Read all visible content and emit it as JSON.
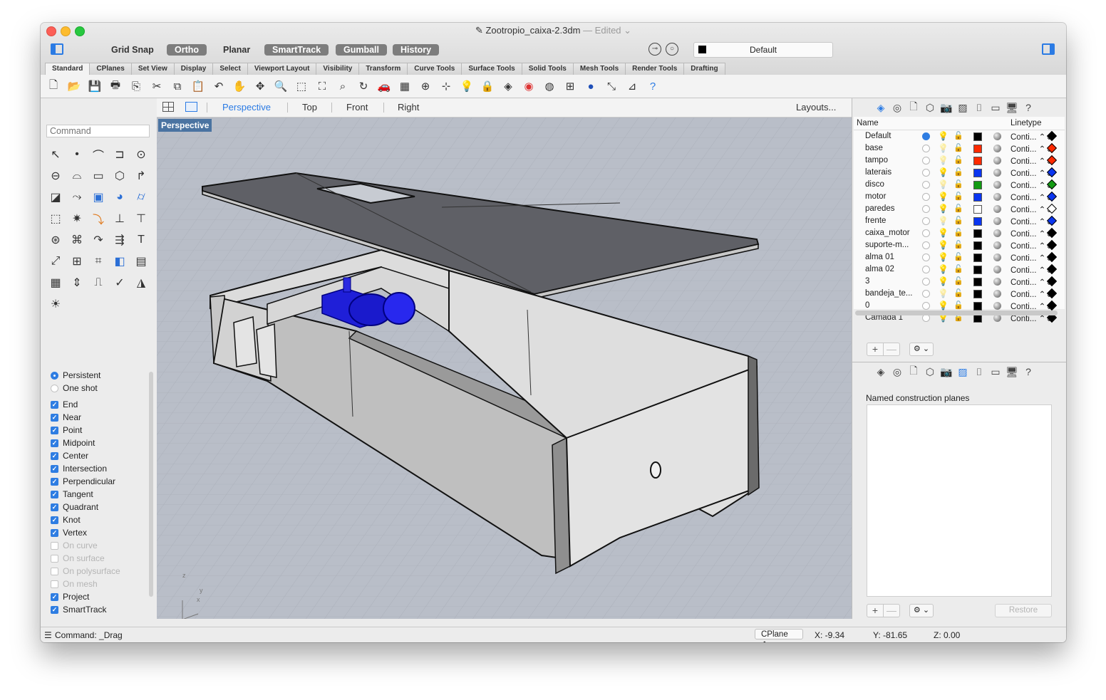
{
  "window": {
    "title": "Zootropio_caixa-2.3dm",
    "title_suffix": "— Edited ⌄"
  },
  "modes": [
    {
      "label": "Grid Snap",
      "active": false
    },
    {
      "label": "Ortho",
      "active": true
    },
    {
      "label": "Planar",
      "active": false
    },
    {
      "label": "SmartTrack",
      "active": true
    },
    {
      "label": "Gumball",
      "active": true
    },
    {
      "label": "History",
      "active": true
    }
  ],
  "layer_selector": {
    "current": "Default",
    "color": "#000000"
  },
  "tabs": [
    "Standard",
    "CPlanes",
    "Set View",
    "Display",
    "Select",
    "Viewport Layout",
    "Visibility",
    "Transform",
    "Curve Tools",
    "Surface Tools",
    "Solid Tools",
    "Mesh Tools",
    "Render Tools",
    "Drafting"
  ],
  "active_tab": "Standard",
  "toolbar_icons": [
    "new-file-icon",
    "open-folder-icon",
    "save-icon",
    "print-icon",
    "import-icon",
    "cut-icon",
    "copy-icon",
    "paste-icon",
    "undo-icon",
    "pan-hand-icon",
    "move-view-icon",
    "zoom-icon",
    "zoom-window-icon",
    "zoom-extents-icon",
    "zoom-selected-icon",
    "rotate-view-icon",
    "car-render-icon",
    "grid-icon",
    "cplane-icon",
    "snap-icon",
    "light-icon",
    "lock-icon",
    "layer-icon",
    "color-wheel-icon",
    "wireframe-sphere-icon",
    "mesh-sphere-icon",
    "render-sphere-icon",
    "dimension-icon",
    "measure-icon",
    "help-icon"
  ],
  "command": {
    "placeholder": "Command"
  },
  "palette_icons": [
    "select-arrow-icon",
    "point-icon",
    "polyline-icon",
    "curve-icon",
    "circle-icon",
    "ellipse-icon",
    "arc-icon",
    "rectangle-icon",
    "polygon-icon",
    "fillet-icon",
    "surface-icon",
    "sweep-icon",
    "box-icon",
    "sphere-icon",
    "cylinder-icon",
    "extrude-icon",
    "explode-icon",
    "trim-icon",
    "split-icon",
    "join-icon",
    "boolean-icon",
    "group-icon",
    "curve-from-object-icon",
    "offset-icon",
    "text-icon",
    "transform-icon",
    "array-icon",
    "properties-icon",
    "block-icon",
    "dimension-icon",
    "grid-array-icon",
    "align-icon",
    "analyze-icon",
    "check-icon",
    "display-mode-icon",
    "sun-icon"
  ],
  "osnap": {
    "radio": [
      {
        "label": "Persistent",
        "checked": true
      },
      {
        "label": "One shot",
        "checked": false
      }
    ],
    "items": [
      {
        "label": "End",
        "checked": true
      },
      {
        "label": "Near",
        "checked": true
      },
      {
        "label": "Point",
        "checked": true
      },
      {
        "label": "Midpoint",
        "checked": true
      },
      {
        "label": "Center",
        "checked": true
      },
      {
        "label": "Intersection",
        "checked": true
      },
      {
        "label": "Perpendicular",
        "checked": true
      },
      {
        "label": "Tangent",
        "checked": true
      },
      {
        "label": "Quadrant",
        "checked": true
      },
      {
        "label": "Knot",
        "checked": true
      },
      {
        "label": "Vertex",
        "checked": true
      },
      {
        "label": "On curve",
        "checked": false
      },
      {
        "label": "On surface",
        "checked": false
      },
      {
        "label": "On polysurface",
        "checked": false
      },
      {
        "label": "On mesh",
        "checked": false
      },
      {
        "label": "Project",
        "checked": true
      },
      {
        "label": "SmartTrack",
        "checked": true
      }
    ]
  },
  "viewport_tabs": [
    "Perspective",
    "Top",
    "Front",
    "Right"
  ],
  "active_viewport": "Perspective",
  "layouts_label": "Layouts...",
  "viewport_label": "Perspective",
  "axes": {
    "z": "z",
    "y": "y",
    "x": "x"
  },
  "layers": {
    "headers": {
      "name": "Name",
      "linetype": "Linetype"
    },
    "rows": [
      {
        "name": "Default",
        "current": true,
        "color": "#000000",
        "linetype": "Conti... ⌃⌄",
        "print_color": "#000000",
        "bulb_on": true
      },
      {
        "name": "base",
        "current": false,
        "color": "#ff2a00",
        "linetype": "Conti... ⌃⌄",
        "print_color": "#ff2a00",
        "bulb_on": false
      },
      {
        "name": "tampo",
        "current": false,
        "color": "#ff2a00",
        "linetype": "Conti... ⌃⌄",
        "print_color": "#ff2a00",
        "bulb_on": false
      },
      {
        "name": "laterais",
        "current": false,
        "color": "#0a35f0",
        "linetype": "Conti... ⌃⌄",
        "print_color": "#0a35f0",
        "bulb_on": true
      },
      {
        "name": "disco",
        "current": false,
        "color": "#129a12",
        "linetype": "Conti... ⌃⌄",
        "print_color": "#129a12",
        "bulb_on": false
      },
      {
        "name": "motor",
        "current": false,
        "color": "#0a35f0",
        "linetype": "Conti... ⌃⌄",
        "print_color": "#0a35f0",
        "bulb_on": true
      },
      {
        "name": "paredes",
        "current": false,
        "color": "#ffffff",
        "linetype": "Conti... ⌃⌄",
        "print_color": "#ffffff",
        "bulb_on": true
      },
      {
        "name": "frente",
        "current": false,
        "color": "#0a35f0",
        "linetype": "Conti... ⌃⌄",
        "print_color": "#0a35f0",
        "bulb_on": false
      },
      {
        "name": "caixa_motor",
        "current": false,
        "color": "#000000",
        "linetype": "Conti... ⌃⌄",
        "print_color": "#000000",
        "bulb_on": true
      },
      {
        "name": "suporte-m...",
        "current": false,
        "color": "#000000",
        "linetype": "Conti... ⌃⌄",
        "print_color": "#000000",
        "bulb_on": true
      },
      {
        "name": "alma 01",
        "current": false,
        "color": "#000000",
        "linetype": "Conti... ⌃⌄",
        "print_color": "#000000",
        "bulb_on": true
      },
      {
        "name": "alma 02",
        "current": false,
        "color": "#000000",
        "linetype": "Conti... ⌃⌄",
        "print_color": "#000000",
        "bulb_on": true
      },
      {
        "name": "3",
        "current": false,
        "color": "#000000",
        "linetype": "Conti... ⌃⌄",
        "print_color": "#000000",
        "bulb_on": true
      },
      {
        "name": "bandeja_te...",
        "current": false,
        "color": "#000000",
        "linetype": "Conti... ⌃⌄",
        "print_color": "#000000",
        "bulb_on": false
      },
      {
        "name": "0",
        "current": false,
        "color": "#000000",
        "linetype": "Conti... ⌃⌄",
        "print_color": "#000000",
        "bulb_on": true
      },
      {
        "name": "Camada 1",
        "current": false,
        "color": "#000000",
        "linetype": "Conti... ⌃⌄",
        "print_color": "#000000",
        "bulb_on": true
      }
    ]
  },
  "panel_icons": [
    "layers-icon",
    "materials-icon",
    "document-icon",
    "object-icon",
    "camera-icon",
    "cplane-panel-icon",
    "display-icon",
    "viewport-panel-icon",
    "screen-icon",
    "help-icon"
  ],
  "ncp": {
    "title": "Named construction planes",
    "restore": "Restore"
  },
  "controls": {
    "plus": "+",
    "minus": "—",
    "gear": "⚙ ⌄"
  },
  "status": {
    "command": "Command: _Drag",
    "cplane": "CPlane",
    "x": "X: -9.34",
    "y": "Y: -81.65",
    "z": "Z: 0.00"
  }
}
